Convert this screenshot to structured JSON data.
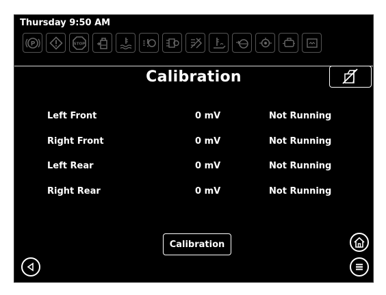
{
  "status": {
    "datetime": "Thursday 9:50 AM",
    "icons": [
      "parking-brake-icon",
      "warning-icon",
      "stop-icon",
      "fuel-level-icon",
      "coolant-temperature-icon",
      "transmission-warning-icon",
      "transmission-fault-icon",
      "sensor-fault-icon",
      "oil-temperature-icon",
      "fuel-filter-icon",
      "oil-pressure-icon",
      "battery-icon",
      "engine-icon"
    ]
  },
  "page": {
    "title": "Calibration"
  },
  "table": {
    "rows": [
      {
        "label": "Left Front",
        "value": "0 mV",
        "status": "Not Running"
      },
      {
        "label": "Right Front",
        "value": "0 mV",
        "status": "Not Running"
      },
      {
        "label": "Left Rear",
        "value": "0 mV",
        "status": "Not Running"
      },
      {
        "label": "Right Rear",
        "value": "0 mV",
        "status": "Not Running"
      }
    ]
  },
  "actions": {
    "calibration_label": "Calibration"
  },
  "colors": {
    "background": "#000000",
    "text": "#ffffff",
    "icon_outline": "#555555",
    "frame": "#ffffff"
  }
}
